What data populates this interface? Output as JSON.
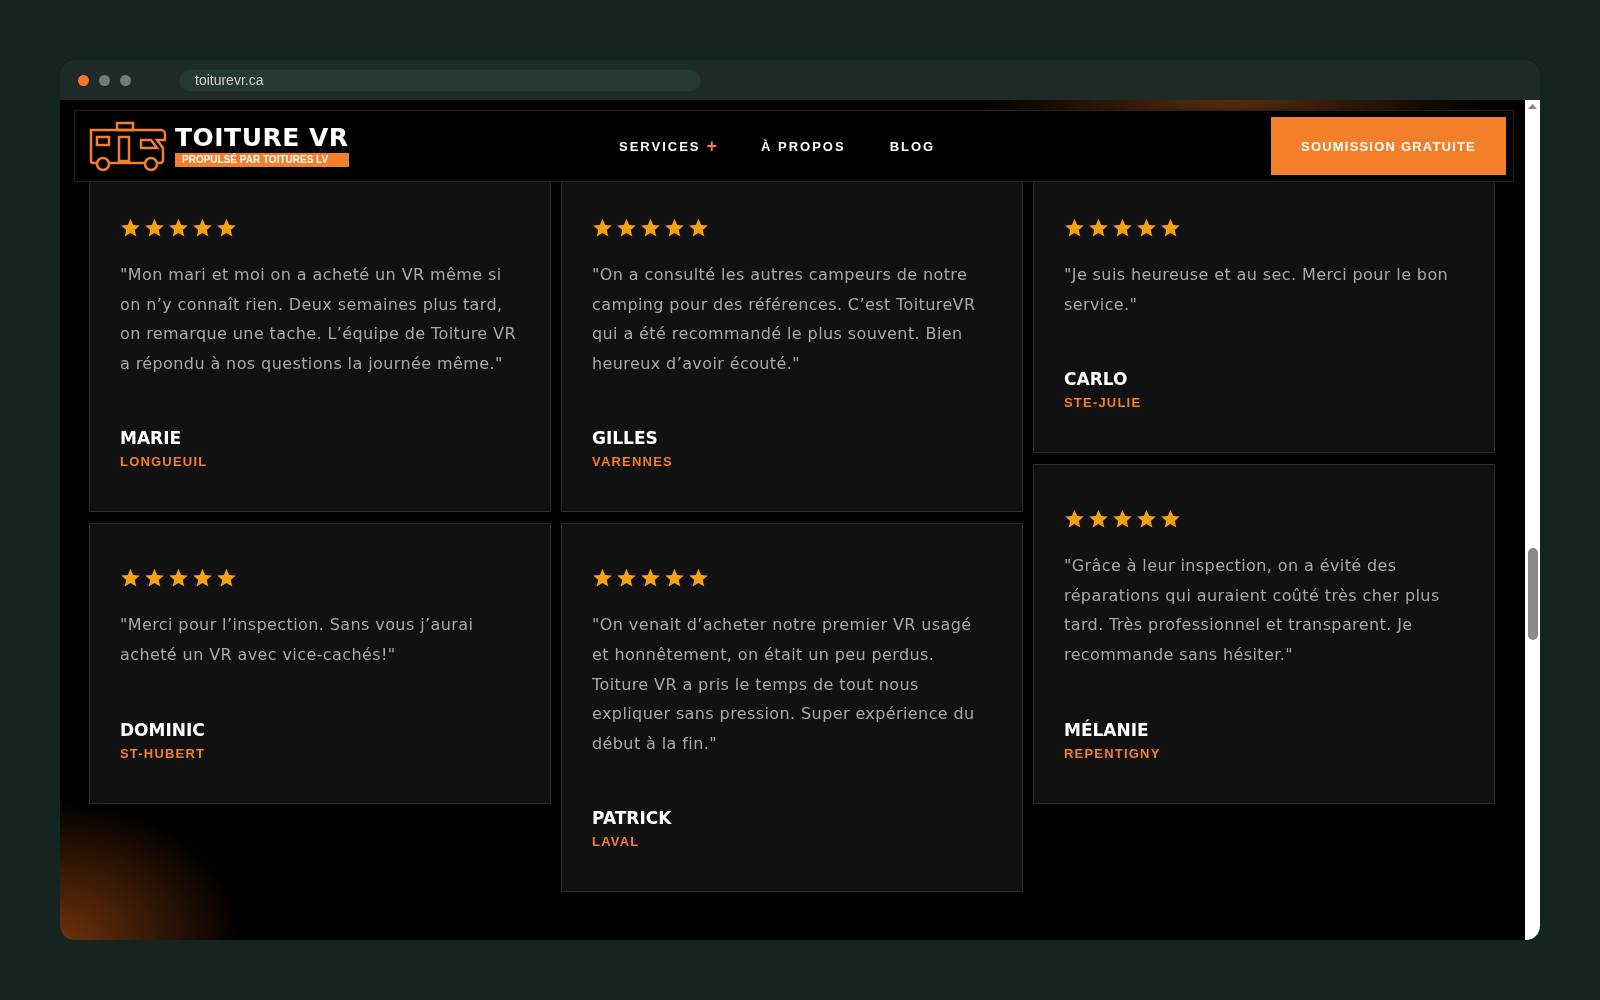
{
  "browser": {
    "url": "toiturevr.ca"
  },
  "header": {
    "brand": "TOITURE VR",
    "tagline": "PROPULSÉ PAR TOITURES LV",
    "nav": [
      {
        "label": "SERVICES",
        "suffix": "+"
      },
      {
        "label": "À PROPOS"
      },
      {
        "label": "BLOG"
      }
    ],
    "cta": "SOUMISSION GRATUITE"
  },
  "columns": [
    {
      "reviews": [
        {
          "stars": 5,
          "text": "\"Mon mari et moi on a acheté un VR même si on n’y connaît rien. Deux semaines plus tard, on remarque une tache. L’équipe de Toiture VR a répondu à nos questions la journée même.\"",
          "name": "MARIE",
          "city": "LONGUEUIL"
        },
        {
          "stars": 5,
          "text": "\"Merci pour l’inspection.  Sans vous j’aurai acheté un VR avec vice-cachés!\"",
          "name": "DOMINIC",
          "city": "ST-HUBERT"
        }
      ]
    },
    {
      "reviews": [
        {
          "stars": 5,
          "text": "\"On a consulté les autres campeurs de notre camping pour des références.  C’est ToitureVR qui a été recommandé le plus souvent. Bien heureux d’avoir écouté.\"",
          "name": "GILLES",
          "city": "VARENNES"
        },
        {
          "stars": 5,
          "text": "\"On venait d’acheter notre premier VR usagé et honnêtement, on était un peu perdus. Toiture VR a pris le temps de tout nous expliquer sans pression. Super expérience du début à la fin.\"",
          "name": "PATRICK",
          "city": "LAVAL"
        }
      ]
    },
    {
      "reviews": [
        {
          "stars": 5,
          "text": "\"Je suis heureuse et au sec. Merci pour le bon service.\"",
          "name": "CARLO",
          "city": "STE-JULIE"
        },
        {
          "stars": 5,
          "text": "\"Grâce à leur inspection, on a évité des réparations qui auraient coûté très cher plus tard. Très professionnel et transparent. Je recommande sans hésiter.\"",
          "name": "MÉLANIE",
          "city": "REPENTIGNY"
        }
      ]
    }
  ]
}
